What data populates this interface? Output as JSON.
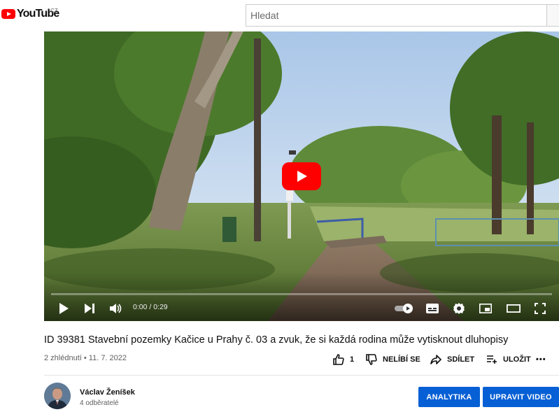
{
  "header": {
    "logo_text": "YouTube",
    "country_code": "CZ",
    "search_placeholder": "Hledat"
  },
  "player": {
    "time": "0:00 / 0:29",
    "progress_fraction": 0,
    "controls": [
      "play-icon",
      "next-icon",
      "volume-icon",
      "autoplay-toggle-icon",
      "subtitles-icon",
      "settings-icon",
      "miniplayer-icon",
      "theater-icon",
      "fullscreen-icon"
    ]
  },
  "video": {
    "title": "ID 39381 Stavební pozemky Kačice u Prahy č. 03 a zvuk, že si každá rodina může vytisknout dluhopisy",
    "meta": "2 zhlédnutí • 11. 7. 2022"
  },
  "actions": {
    "like_count": "1",
    "dislike_label": "NELÍBÍ SE",
    "share_label": "SDÍLET",
    "save_label": "ULOŽIT",
    "more_label": "•••"
  },
  "channel": {
    "name": "Václav Ženíšek",
    "subscribers": "4 odběratelé"
  },
  "buttons": {
    "analytics_label": "ANALYTIKA",
    "edit_label": "UPRAVIT VIDEO"
  },
  "colors": {
    "brand_red": "#ff0000",
    "primary_button": "#065fd4"
  }
}
